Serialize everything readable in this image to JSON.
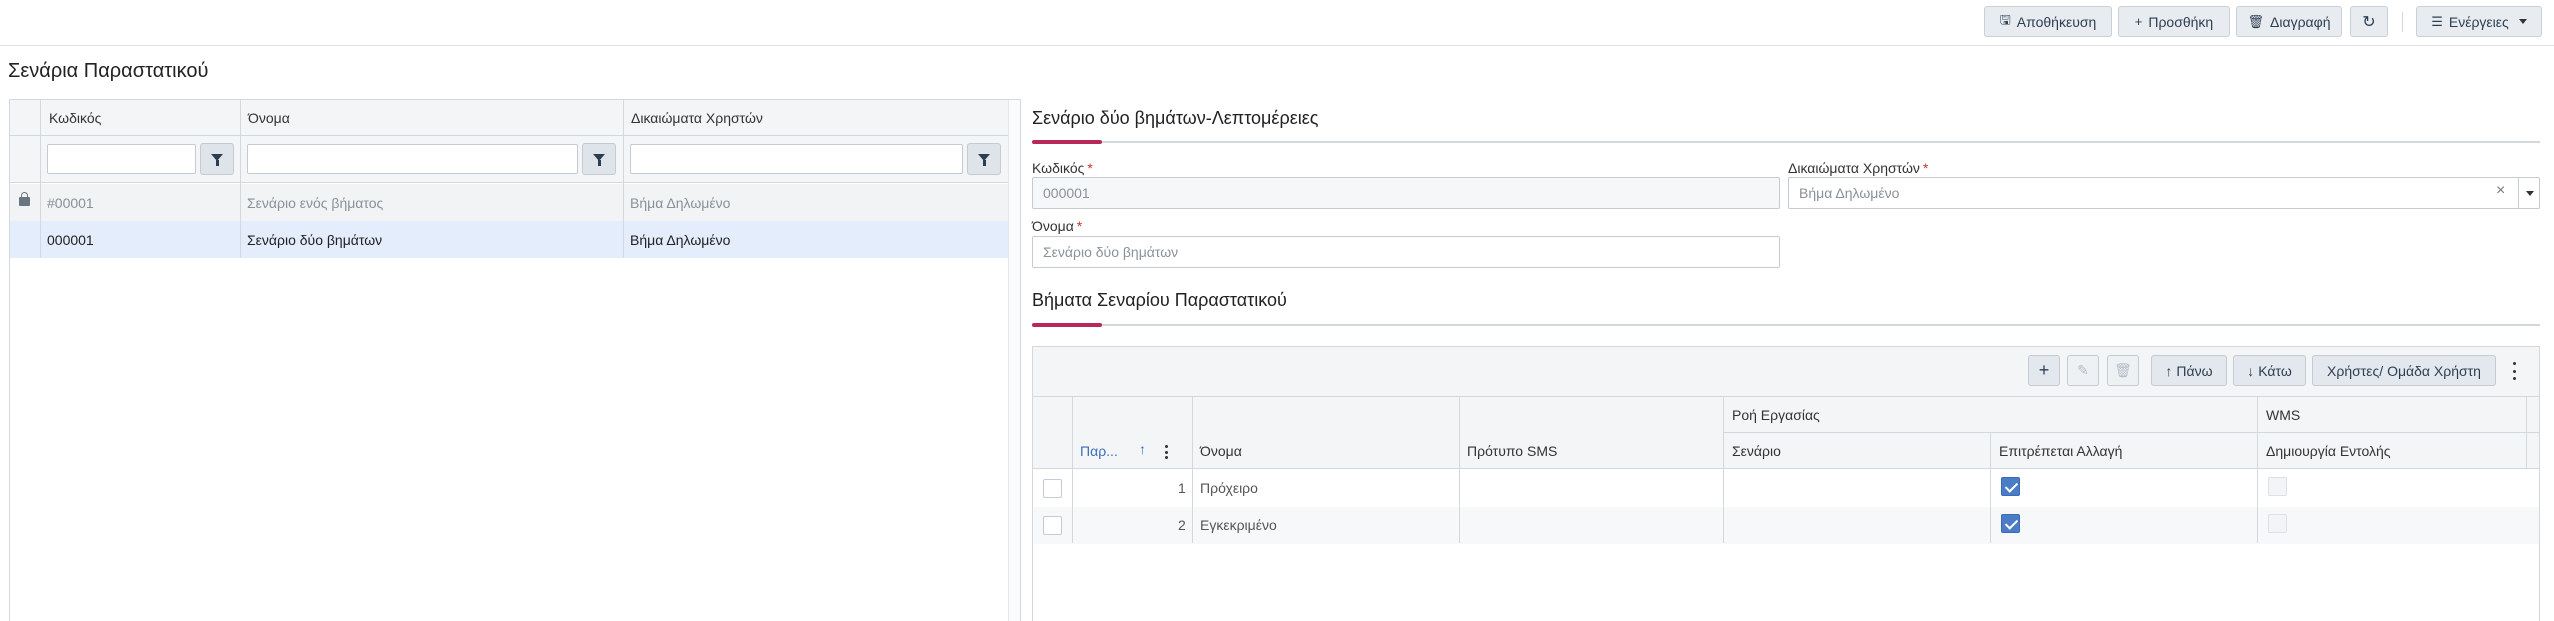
{
  "toolbar": {
    "save": "Αποθήκευση",
    "add": "Προσθήκη",
    "delete": "Διαγραφή",
    "actions": "Ενέργειες"
  },
  "page_title": "Σενάρια Παραστατικού",
  "list_grid": {
    "columns": [
      "Κωδικός",
      "Όνομα",
      "Δικαιώματα Χρηστών"
    ],
    "rows": [
      {
        "code": "#00001",
        "name": "Σενάριο ενός βήματος",
        "rights": "Βήμα Δηλωμένο",
        "locked": true
      },
      {
        "code": "000001",
        "name": "Σενάριο δύο βημάτων",
        "rights": "Βήμα Δηλωμένο",
        "selected": true
      }
    ]
  },
  "details": {
    "title": "Σενάριο δύο βημάτων-Λεπτομέρειες",
    "code_label": "Κωδικός",
    "code_value": "000001",
    "rights_label": "Δικαιώματα Χρηστών",
    "rights_value": "Βήμα Δηλωμένο",
    "name_label": "Όνομα",
    "name_value": "Σενάριο δύο βημάτων",
    "required_mark": "*"
  },
  "steps": {
    "title": "Βήματα Σεναρίου Παραστατικού",
    "toolbar": {
      "add": "+",
      "up": "Πάνω",
      "down": "Κάτω",
      "users": "Χρήστες/ Ομάδα Χρήστη"
    },
    "group_headers": {
      "workflow": "Ροή Εργασίας",
      "wms": "WMS"
    },
    "columns": {
      "order": "Παρ...",
      "name": "Όνομα",
      "sms": "Πρότυπο SMS",
      "scenario": "Σενάριο",
      "allow_change": "Επιτρέπεται Αλλαγή",
      "create_order": "Δημιουργία Εντολής"
    },
    "rows": [
      {
        "order": "1",
        "name": "Πρόχειρο",
        "allow_change": true,
        "create_order": false
      },
      {
        "order": "2",
        "name": "Εγκεκριμένο",
        "allow_change": true,
        "create_order": false
      }
    ]
  }
}
